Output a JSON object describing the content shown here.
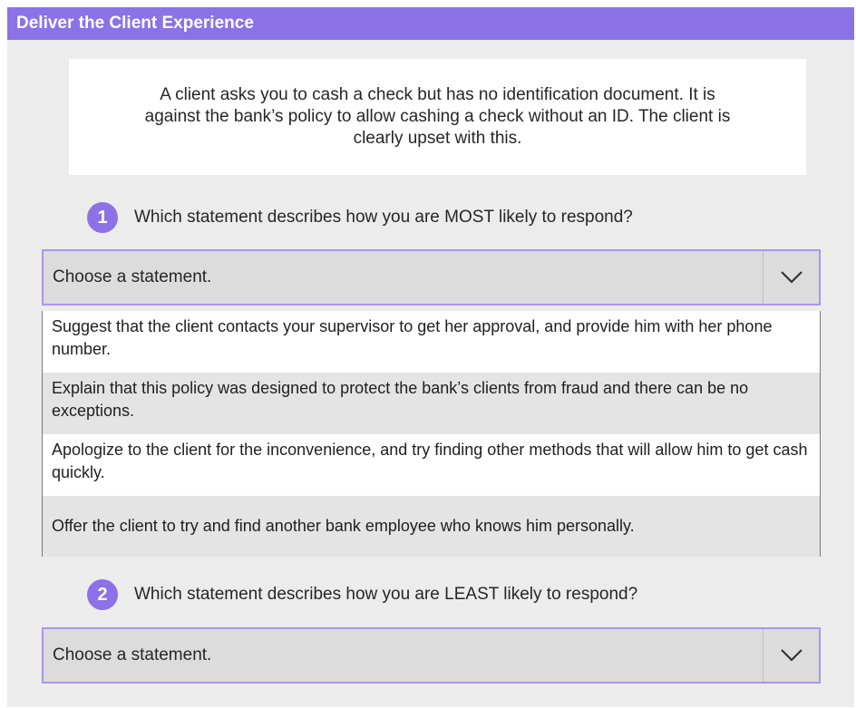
{
  "header": {
    "title": "Deliver the Client Experience"
  },
  "scenario": {
    "text": "A client asks you to cash a check but has no identification document. It is against the bank’s policy to allow cashing a check without an ID. The client is clearly upset with this."
  },
  "questions": [
    {
      "number": "1",
      "text": "Which statement describes how you are MOST likely to respond?",
      "placeholder": "Choose a statement.",
      "expanded": true
    },
    {
      "number": "2",
      "text": "Which statement describes how you are LEAST likely to respond?",
      "placeholder": "Choose a statement.",
      "expanded": false
    }
  ],
  "options": [
    "Suggest that the client contacts your supervisor to get her approval, and provide him with her phone number.",
    "Explain that this policy was designed to protect the bank’s clients from fraud and there can be no exceptions.",
    "Apologize to the client for the inconvenience, and try finding other methods that will allow him to get cash quickly.",
    "Offer the client to try and find another bank employee who knows him personally."
  ],
  "colors": {
    "accent": "#8b72e6",
    "select_border": "#a996ee",
    "select_bg": "#dcdcdc",
    "panel_bg": "#ececec"
  },
  "icons": {
    "dropdown": "chevron-down-icon"
  }
}
